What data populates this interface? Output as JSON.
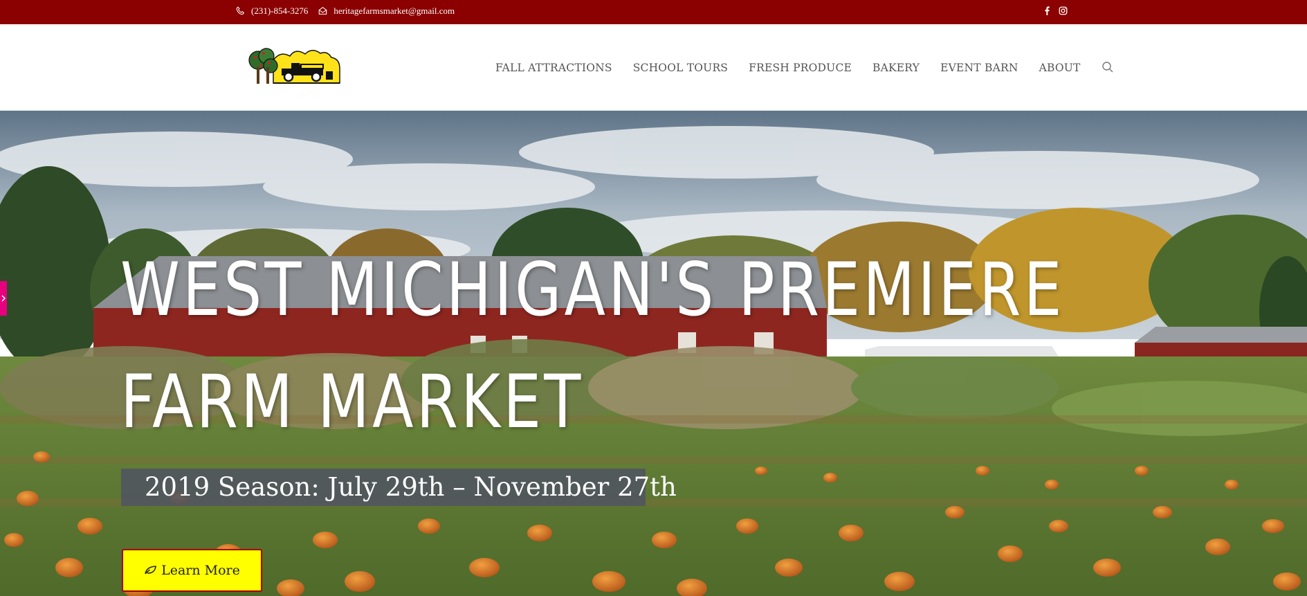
{
  "topbar": {
    "phone": "(231)-854-3276",
    "email": "heritagefarmsmarket@gmail.com",
    "phone_icon": "phone-icon",
    "email_icon": "envelope-icon",
    "social": [
      "facebook-icon",
      "instagram-icon"
    ],
    "bg_color": "#8b0000"
  },
  "header": {
    "nav": [
      "FALL ATTRACTIONS",
      "SCHOOL TOURS",
      "FRESH PRODUCE",
      "BAKERY",
      "EVENT BARN",
      "ABOUT"
    ],
    "search_icon": "search-icon"
  },
  "hero": {
    "headline": "West Michigan's Premiere Farm Market",
    "season": "2019 Season: July 29th – November 27th",
    "cta_label": "Learn More",
    "cta_icon": "leaf-icon",
    "cta_color": "#ffff00"
  }
}
